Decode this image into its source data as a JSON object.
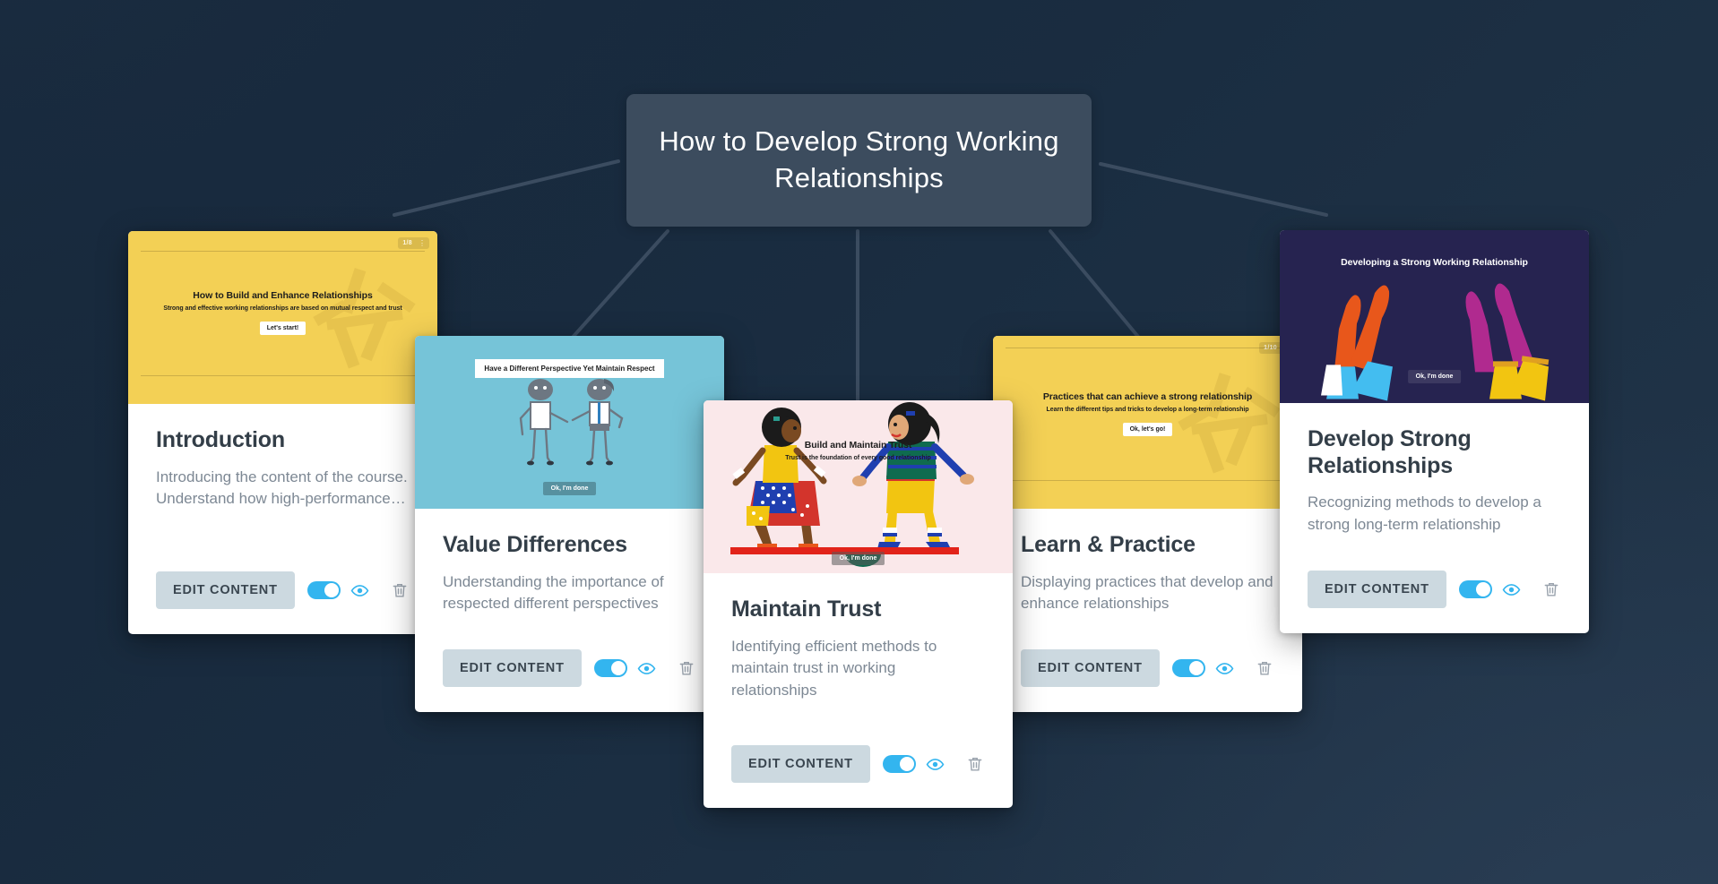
{
  "canvas": {
    "background_color": "#17293c",
    "accent_color": "#33b5ef"
  },
  "title_node": {
    "title": "How to Develop Strong Working Relationships",
    "background_color": "#3c4c5e",
    "text_color": "#ffffff"
  },
  "actions": {
    "edit_label": "EDIT CONTENT",
    "toggle_icon": "toggle-on-icon",
    "visibility_icon": "eye-icon",
    "delete_icon": "trash-icon",
    "toggle_state": "on"
  },
  "cards": [
    {
      "id": "introduction",
      "title": "Introduction",
      "description": "Introducing the content of the course. Understand how high-performance…",
      "thumb_bg": "#f3d055",
      "thumb_kind": "yellow-title-slide",
      "badge": "1/8",
      "slide": {
        "heading": "How to Build and Enhance Relationships",
        "subheading": "Strong and effective working relationships are based on mutual respect and trust",
        "cta": "Let's start!"
      }
    },
    {
      "id": "value-differences",
      "title": "Value Differences",
      "description": "Understanding the importance of respected different perspectives",
      "thumb_bg": "#76c4d8",
      "thumb_kind": "teal-handshake-slide",
      "badge": "",
      "slide": {
        "heading": "Have a Different Perspective Yet Maintain Respect",
        "subheading": "",
        "cta": "Ok, I'm done"
      }
    },
    {
      "id": "maintain-trust",
      "title": "Maintain Trust",
      "description": "Identifying efficient methods to maintain trust in working relationships",
      "thumb_bg": "#fae8ea",
      "thumb_kind": "pink-seesaw-slide",
      "badge": "",
      "slide": {
        "heading": "Build and Maintain Trust",
        "subheading": "Trust is the foundation of every good relationship",
        "cta": "Ok, I'm done"
      }
    },
    {
      "id": "learn-practice",
      "title": "Learn & Practice",
      "description": "Displaying practices that develop and enhance relationships",
      "thumb_bg": "#f3d055",
      "thumb_kind": "yellow-title-slide",
      "badge": "1/10",
      "slide": {
        "heading": "Practices that can achieve a strong relationship",
        "subheading": "Learn the different tips and tricks to develop a long-term relationship",
        "cta": "Ok, let's go!"
      }
    },
    {
      "id": "develop-strong-relationships",
      "title": "Develop Strong Relationships",
      "description": "Recognizing methods to develop a strong long-term relationship",
      "thumb_bg": "#262350",
      "thumb_kind": "dark-hands-slide",
      "badge": "",
      "slide": {
        "heading": "Developing a Strong Working Relationship",
        "subheading": "",
        "cta": "Ok, I'm done"
      }
    }
  ]
}
